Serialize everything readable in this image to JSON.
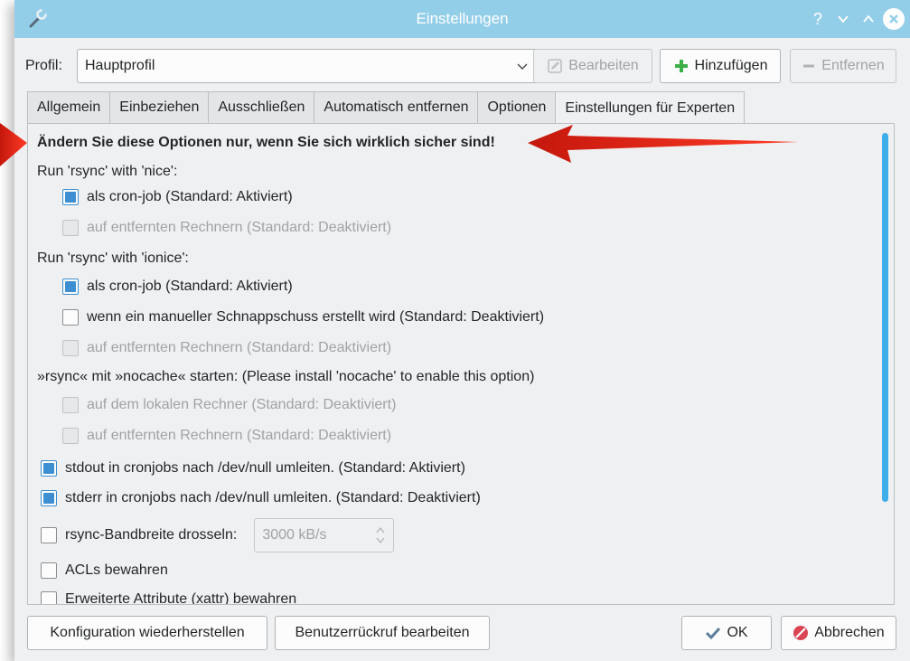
{
  "window": {
    "title": "Einstellungen",
    "help_glyph": "?",
    "min_glyph": "∨",
    "max_glyph": "∧"
  },
  "profile": {
    "label": "Profil:",
    "selected": "Hauptprofil",
    "edit_label": "Bearbeiten",
    "add_label": "Hinzufügen",
    "remove_label": "Entfernen"
  },
  "tabs": [
    {
      "label": "Allgemein"
    },
    {
      "label": "Einbeziehen"
    },
    {
      "label": "Ausschließen"
    },
    {
      "label": "Automatisch entfernen"
    },
    {
      "label": "Optionen"
    },
    {
      "label": "Einstellungen für Experten",
      "active": true
    }
  ],
  "expert": {
    "warning": "Ändern Sie diese Optionen nur, wenn Sie sich wirklich sicher sind!",
    "nice_header": "Run 'rsync' with 'nice':",
    "nice_cron": {
      "label": "als cron-job (Standard: Aktiviert)",
      "checked": true
    },
    "nice_remote": {
      "label": "auf entfernten Rechnern (Standard: Deaktiviert)",
      "checked": false,
      "disabled": true
    },
    "ionice_header": "Run 'rsync' with 'ionice':",
    "ionice_cron": {
      "label": "als cron-job (Standard: Aktiviert)",
      "checked": true
    },
    "ionice_manual": {
      "label": "wenn ein manueller Schnappschuss erstellt wird (Standard: Deaktiviert)",
      "checked": false
    },
    "ionice_remote": {
      "label": "auf entfernten Rechnern (Standard: Deaktiviert)",
      "checked": false,
      "disabled": true
    },
    "nocache_header": "»rsync« mit »nocache« starten: (Please install 'nocache' to enable this option)",
    "nocache_local": {
      "label": "auf dem lokalen Rechner (Standard: Deaktiviert)",
      "checked": false,
      "disabled": true
    },
    "nocache_remote": {
      "label": "auf entfernten Rechnern (Standard: Deaktiviert)",
      "checked": false,
      "disabled": true
    },
    "stdout": {
      "label": "stdout in cronjobs nach /dev/null umleiten. (Standard: Aktiviert)",
      "checked": true
    },
    "stderr": {
      "label": "stderr in cronjobs nach /dev/null umleiten. (Standard: Deaktiviert)",
      "checked": true
    },
    "bwlimit": {
      "label": "rsync-Bandbreite drosseln:",
      "checked": false,
      "value": "3000 kB/s"
    },
    "acl": {
      "label": "ACLs bewahren",
      "checked": false
    },
    "xattr": {
      "label": "Erweiterte Attribute (xattr) bewahren",
      "checked": false
    }
  },
  "footer": {
    "restore_label": "Konfiguration wiederherstellen",
    "userback_label": "Benutzerrückruf bearbeiten",
    "ok_label": "OK",
    "cancel_label": "Abbrechen"
  },
  "colors": {
    "titlebar": "#93cee9",
    "accent": "#3d8fd1",
    "arrow": "#e52b1e",
    "add_green": "#3cb046",
    "cancel_red": "#da4453"
  }
}
